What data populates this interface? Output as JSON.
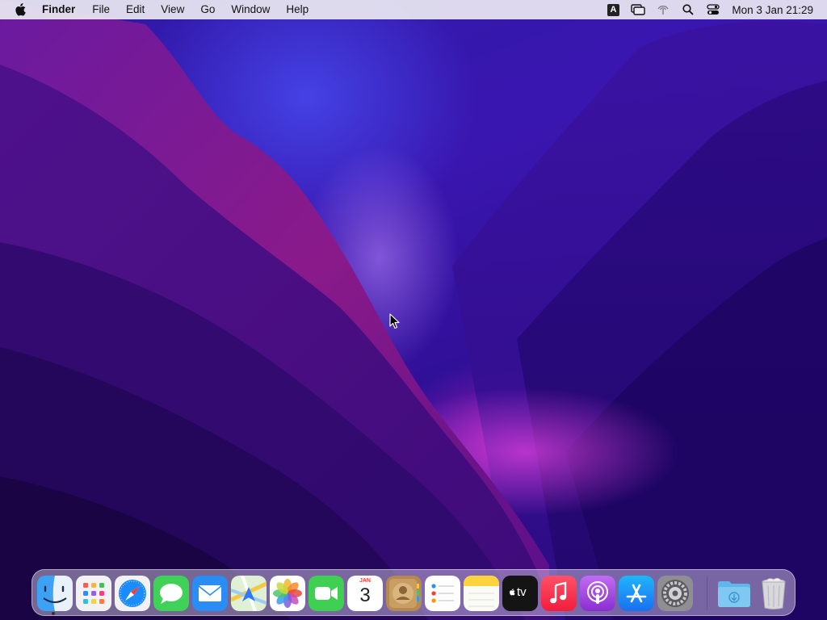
{
  "menubar": {
    "apple_icon": "apple-logo-icon",
    "app_name": "Finder",
    "menus": [
      "File",
      "Edit",
      "View",
      "Go",
      "Window",
      "Help"
    ],
    "status_icons": [
      "input-source-icon",
      "screen-mirroring-icon",
      "airdrop-icon",
      "spotlight-search-icon",
      "control-center-icon"
    ],
    "input_source": "A",
    "clock": "Mon 3 Jan  21:29"
  },
  "dock": {
    "apps": [
      {
        "name": "Finder",
        "icon": "finder-icon",
        "running": true
      },
      {
        "name": "Launchpad",
        "icon": "launchpad-icon"
      },
      {
        "name": "Safari",
        "icon": "safari-icon"
      },
      {
        "name": "Messages",
        "icon": "messages-icon"
      },
      {
        "name": "Mail",
        "icon": "mail-icon"
      },
      {
        "name": "Maps",
        "icon": "maps-icon"
      },
      {
        "name": "Photos",
        "icon": "photos-icon"
      },
      {
        "name": "FaceTime",
        "icon": "facetime-icon"
      },
      {
        "name": "Calendar",
        "icon": "calendar-icon"
      },
      {
        "name": "Contacts",
        "icon": "contacts-icon"
      },
      {
        "name": "Reminders",
        "icon": "reminders-icon"
      },
      {
        "name": "Notes",
        "icon": "notes-icon"
      },
      {
        "name": "TV",
        "icon": "apple-tv-icon"
      },
      {
        "name": "Music",
        "icon": "music-icon"
      },
      {
        "name": "Podcasts",
        "icon": "podcasts-icon"
      },
      {
        "name": "App Store",
        "icon": "app-store-icon"
      },
      {
        "name": "System Preferences",
        "icon": "system-preferences-icon"
      }
    ],
    "others": [
      {
        "name": "Downloads",
        "icon": "downloads-folder-icon"
      },
      {
        "name": "Trash",
        "icon": "trash-icon"
      }
    ],
    "calendar_month": "JAN",
    "calendar_day": "3",
    "tv_label": "tv"
  },
  "colors": {
    "accent_blue": "#1a8cff",
    "menubar_bg": "#ece9f2",
    "wallpaper_deep": "#2e1aa8",
    "wallpaper_magenta": "#c81ec8"
  }
}
